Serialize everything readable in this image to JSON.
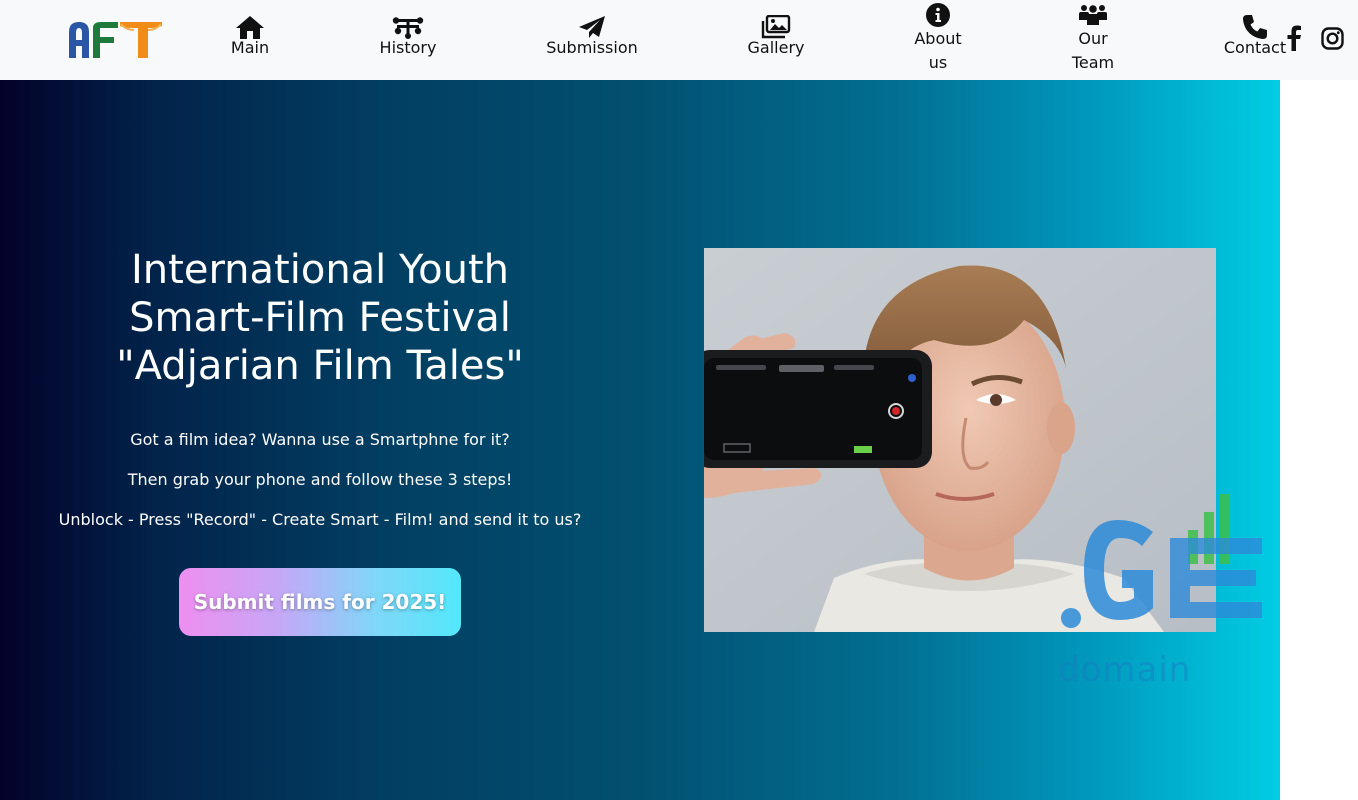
{
  "brand": {
    "logo_text": "AFT"
  },
  "nav": {
    "items": [
      {
        "label": "Main",
        "icon": "home-icon"
      },
      {
        "label": "History",
        "icon": "history-icon"
      },
      {
        "label": "Submission",
        "icon": "paper-plane-icon"
      },
      {
        "label": "Gallery",
        "icon": "images-icon"
      },
      {
        "label": "About us",
        "icon": "info-icon"
      },
      {
        "label": "Our Team",
        "icon": "people-icon"
      },
      {
        "label": "Contact",
        "icon": "phone-icon"
      }
    ],
    "social": [
      "facebook-icon",
      "instagram-icon"
    ]
  },
  "hero": {
    "title": "International Youth\nSmart-Film Festival\n\"Adjarian Film Tales\"",
    "line1": "Got a film idea? Wanna use a Smartphne for it?",
    "line2": "Then grab your phone and follow these 3 steps!",
    "line3": "Unblock - Press \"Record\" - Create Smart - Film! and send it to us?",
    "cta_label": "Submit films for 2025!"
  },
  "watermark": {
    "brand": ".GE",
    "subtext": "domain"
  },
  "colors": {
    "hero_gradient_start": "#03012a",
    "hero_gradient_end": "#00cde3",
    "cta_gradient_start": "#ee8ff0",
    "cta_gradient_end": "#52e8fb",
    "nav_background": "#f8f9fa"
  }
}
